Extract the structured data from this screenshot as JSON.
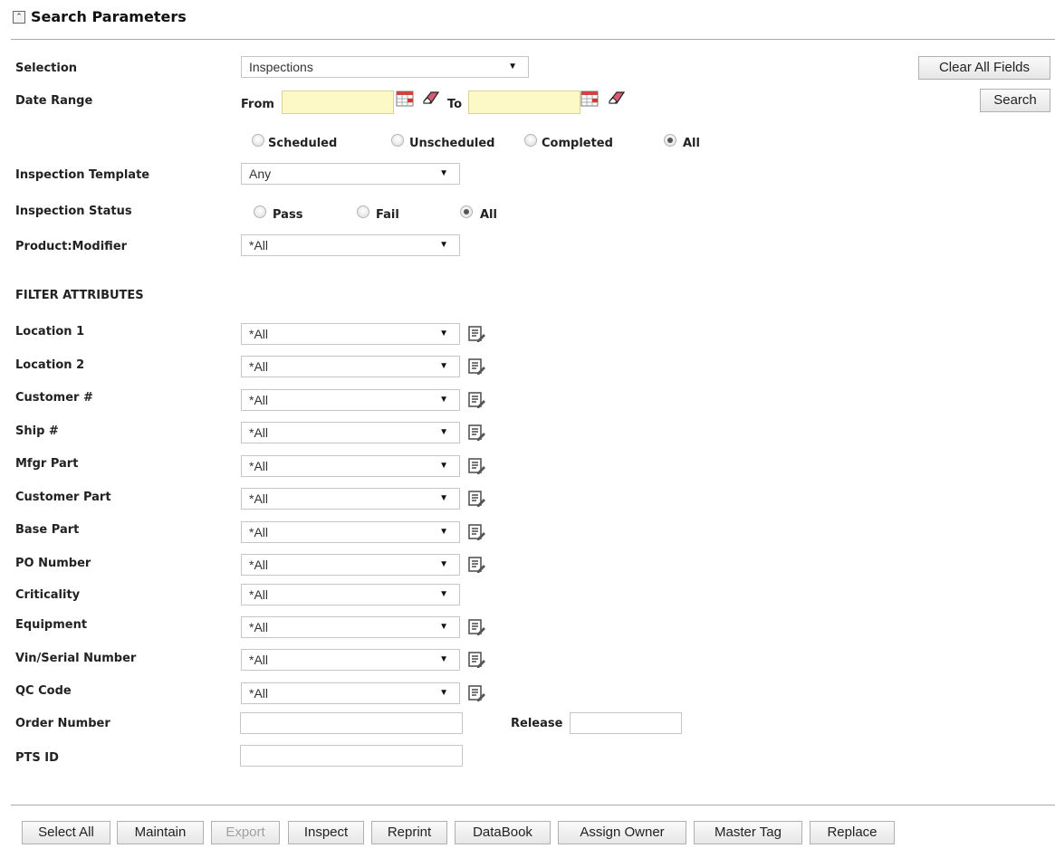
{
  "header": {
    "title": "Search Parameters",
    "collapse_icon": "collapse-up-icon"
  },
  "actions": {
    "clear_all": "Clear All Fields",
    "search": "Search"
  },
  "selection": {
    "label": "Selection",
    "value": "Inspections"
  },
  "date_range": {
    "label": "Date Range",
    "from_label": "From",
    "to_label": "To",
    "from_value": "",
    "to_value": "",
    "field_color": "#fdf9c6",
    "calendar_icon": "calendar-icon",
    "clear_icon": "eraser-icon"
  },
  "schedule_filter": {
    "options": [
      "Scheduled",
      "Unscheduled",
      "Completed",
      "All"
    ],
    "selected": "All"
  },
  "inspection_template": {
    "label": "Inspection Template",
    "value": "Any"
  },
  "inspection_status": {
    "label": "Inspection Status",
    "options": [
      "Pass",
      "Fail",
      "All"
    ],
    "selected": "All"
  },
  "product_modifier": {
    "label": "Product:Modifier",
    "value": "*All"
  },
  "filter_attributes": {
    "heading": "FILTER ATTRIBUTES",
    "rows": [
      {
        "label": "Location 1",
        "value": "*All",
        "has_list_icon": true
      },
      {
        "label": "Location 2",
        "value": "*All",
        "has_list_icon": true
      },
      {
        "label": "Customer #",
        "value": "*All",
        "has_list_icon": true
      },
      {
        "label": "Ship #",
        "value": "*All",
        "has_list_icon": true
      },
      {
        "label": "Mfgr Part",
        "value": "*All",
        "has_list_icon": true
      },
      {
        "label": "Customer Part",
        "value": "*All",
        "has_list_icon": true
      },
      {
        "label": "Base Part",
        "value": "*All",
        "has_list_icon": true
      },
      {
        "label": "PO Number",
        "value": "*All",
        "has_list_icon": true
      },
      {
        "label": "Criticality",
        "value": "*All",
        "has_list_icon": false
      },
      {
        "label": "Equipment",
        "value": "*All",
        "has_list_icon": true
      },
      {
        "label": "Vin/Serial Number",
        "value": "*All",
        "has_list_icon": true
      },
      {
        "label": "QC Code",
        "value": "*All",
        "has_list_icon": true
      }
    ]
  },
  "order_number": {
    "label": "Order Number",
    "value": ""
  },
  "release": {
    "label": "Release",
    "value": ""
  },
  "pts_id": {
    "label": "PTS ID",
    "value": ""
  },
  "toolbar": {
    "buttons": [
      "Select All",
      "Maintain",
      "Export",
      "Inspect",
      "Reprint",
      "DataBook",
      "Assign Owner",
      "Master Tag",
      "Replace"
    ],
    "disabled": [
      "Export"
    ]
  }
}
